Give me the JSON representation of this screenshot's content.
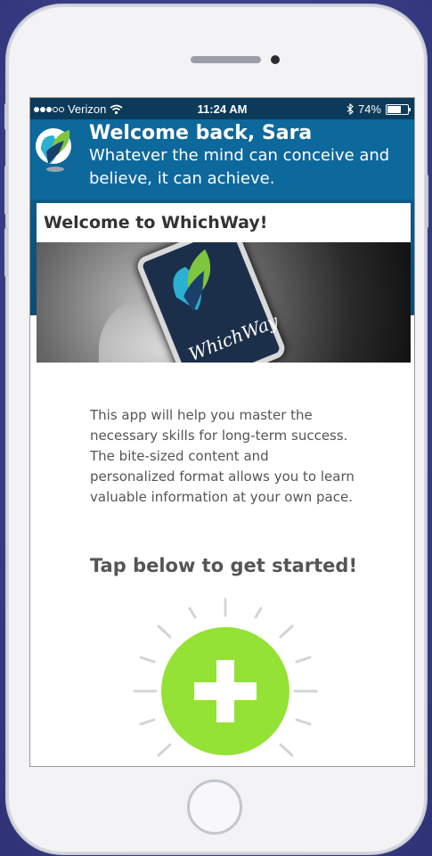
{
  "status_bar": {
    "carrier": "Verizon",
    "time": "11:24 AM",
    "battery": "74%",
    "signal_bars_filled": 3,
    "signal_bars_total": 5,
    "battery_level": 0.74
  },
  "header": {
    "title": "Welcome back, Sara",
    "quote": "Whatever the mind can conceive and believe, it can achieve."
  },
  "card": {
    "title": "Welcome to WhichWay!",
    "hero_brand": "WhichWay",
    "description": "This app will help you master the necessary skills for long-term success. The bite-sized content and personalized format allows you to learn valuable information at your own pace.",
    "cta": "Tap below to get started!"
  },
  "icons": {
    "logo": "whichway-logo-icon",
    "wifi": "wifi-icon",
    "bluetooth": "bluetooth-icon",
    "battery": "battery-icon",
    "add": "plus-icon"
  },
  "colors": {
    "status_bar": "#0b3a5a",
    "header": "#0d689c",
    "accent_green": "#94e235",
    "text": "#555555"
  }
}
